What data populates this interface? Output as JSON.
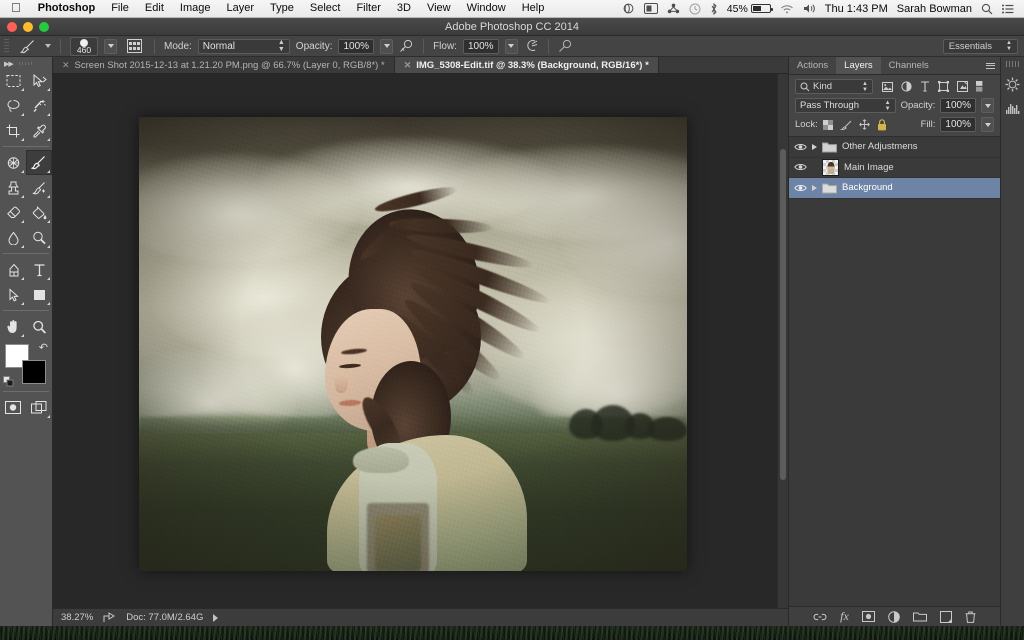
{
  "menubar": {
    "apple_icon": "apple-icon",
    "items": [
      "Photoshop",
      "File",
      "Edit",
      "Image",
      "Layer",
      "Type",
      "Select",
      "Filter",
      "3D",
      "View",
      "Window",
      "Help"
    ],
    "status": {
      "dropbox_icon": "dropbox-icon",
      "display_icon": "display-icon",
      "sync_icon": "sync-icon",
      "timemachine_icon": "time-machine-icon",
      "bluetooth_icon": "bluetooth-icon",
      "battery_percent": "45%",
      "wifi_icon": "wifi-icon",
      "volume_icon": "volume-icon",
      "clock": "Thu 1:43 PM",
      "user": "Sarah Bowman",
      "search_icon": "spotlight-search-icon",
      "notification_icon": "notification-center-icon"
    }
  },
  "window": {
    "title": "Adobe Photoshop CC 2014",
    "traffic": {
      "close": "close-button",
      "minimize": "minimize-button",
      "zoom": "zoom-button"
    }
  },
  "options_bar": {
    "tool_icon": "brush-tool-icon",
    "brush_size": "460",
    "brush_panel_icon": "brush-panel-icon",
    "mode_label": "Mode:",
    "mode_value": "Normal",
    "opacity_label": "Opacity:",
    "opacity_value": "100%",
    "pressure_opacity_icon": "pressure-controls-opacity-icon",
    "flow_label": "Flow:",
    "flow_value": "100%",
    "airbrush_icon": "airbrush-icon",
    "pressure_size_icon": "pressure-controls-size-icon",
    "workspace": "Essentials"
  },
  "tools": [
    {
      "name": "marquee-tool",
      "icon": "marquee-icon"
    },
    {
      "name": "move-tool",
      "icon": "move-icon"
    },
    {
      "name": "lasso-tool",
      "icon": "lasso-icon"
    },
    {
      "name": "quick-selection-tool",
      "icon": "magic-wand-icon"
    },
    {
      "name": "crop-tool",
      "icon": "crop-icon"
    },
    {
      "name": "eyedropper-tool",
      "icon": "eyedropper-icon"
    },
    {
      "name": "spot-healing-tool",
      "icon": "spot-healing-icon"
    },
    {
      "name": "brush-tool",
      "icon": "brush-icon",
      "selected": true
    },
    {
      "name": "clone-stamp-tool",
      "icon": "clone-stamp-icon"
    },
    {
      "name": "history-brush-tool",
      "icon": "history-brush-icon"
    },
    {
      "name": "eraser-tool",
      "icon": "eraser-icon"
    },
    {
      "name": "gradient-tool",
      "icon": "paint-bucket-icon"
    },
    {
      "name": "blur-tool",
      "icon": "blur-icon"
    },
    {
      "name": "dodge-tool",
      "icon": "dodge-icon"
    },
    {
      "name": "pen-tool",
      "icon": "pen-icon"
    },
    {
      "name": "type-tool",
      "icon": "type-icon"
    },
    {
      "name": "path-selection-tool",
      "icon": "path-selection-icon"
    },
    {
      "name": "rectangle-tool",
      "icon": "rectangle-icon"
    },
    {
      "name": "hand-tool",
      "icon": "hand-icon"
    },
    {
      "name": "zoom-tool",
      "icon": "magnifier-icon"
    }
  ],
  "swatches": {
    "foreground": "#ffffff",
    "background": "#000000",
    "swap_icon": "swap-colors-icon",
    "reset_icon": "default-colors-icon"
  },
  "tabs": [
    {
      "label": "Screen Shot 2015-12-13 at 1.21.20 PM.png @ 66.7% (Layer 0, RGB/8*) *",
      "active": false
    },
    {
      "label": "IMG_5308-Edit.tif @ 38.3% (Background, RGB/16*) *",
      "active": true
    }
  ],
  "status_bar": {
    "zoom": "38.27%",
    "share_icon": "share-icon",
    "doc_info": "Doc: 77.0M/2.64G",
    "expand_icon": "status-expand-arrow-icon"
  },
  "panels": {
    "tabs": [
      {
        "label": "Actions",
        "active": false
      },
      {
        "label": "Layers",
        "active": true
      },
      {
        "label": "Channels",
        "active": false
      }
    ],
    "menu_icon": "panel-menu-icon",
    "filter": {
      "search_icon": "search-icon",
      "kind_label": "Kind",
      "icons": [
        "filter-pixel-layers-icon",
        "filter-adjustment-layers-icon",
        "filter-type-layers-icon",
        "filter-shape-layers-icon",
        "filter-smart-object-icon",
        "filter-toggle-icon"
      ]
    },
    "blend_mode": "Pass Through",
    "opacity_label": "Opacity:",
    "opacity_value": "100%",
    "lock_label": "Lock:",
    "lock_icons": [
      "lock-transparent-pixels-icon",
      "lock-image-pixels-icon",
      "lock-position-icon",
      "lock-all-icon"
    ],
    "fill_label": "Fill:",
    "fill_value": "100%",
    "layers": [
      {
        "name": "Other Adjustmens",
        "type": "group",
        "visible": true,
        "selected": false
      },
      {
        "name": "Main Image",
        "type": "layer",
        "visible": true,
        "selected": false
      },
      {
        "name": "Background",
        "type": "group",
        "visible": true,
        "selected": true
      }
    ],
    "footer_icons": [
      "link-layers-icon",
      "layer-style-fx-icon",
      "add-layer-mask-icon",
      "new-adjustment-layer-icon",
      "new-group-icon",
      "new-layer-icon",
      "delete-layer-icon"
    ]
  },
  "minidock": {
    "icons": [
      "adjustments-panel-icon",
      "histogram-panel-icon"
    ]
  },
  "colors": {
    "ui_panel": "#3a3a3a",
    "ui_toolbar": "#535353",
    "canvas_bg": "#282828",
    "layer_selected": "#6d84a6",
    "menubar_bg": "#ededed"
  }
}
